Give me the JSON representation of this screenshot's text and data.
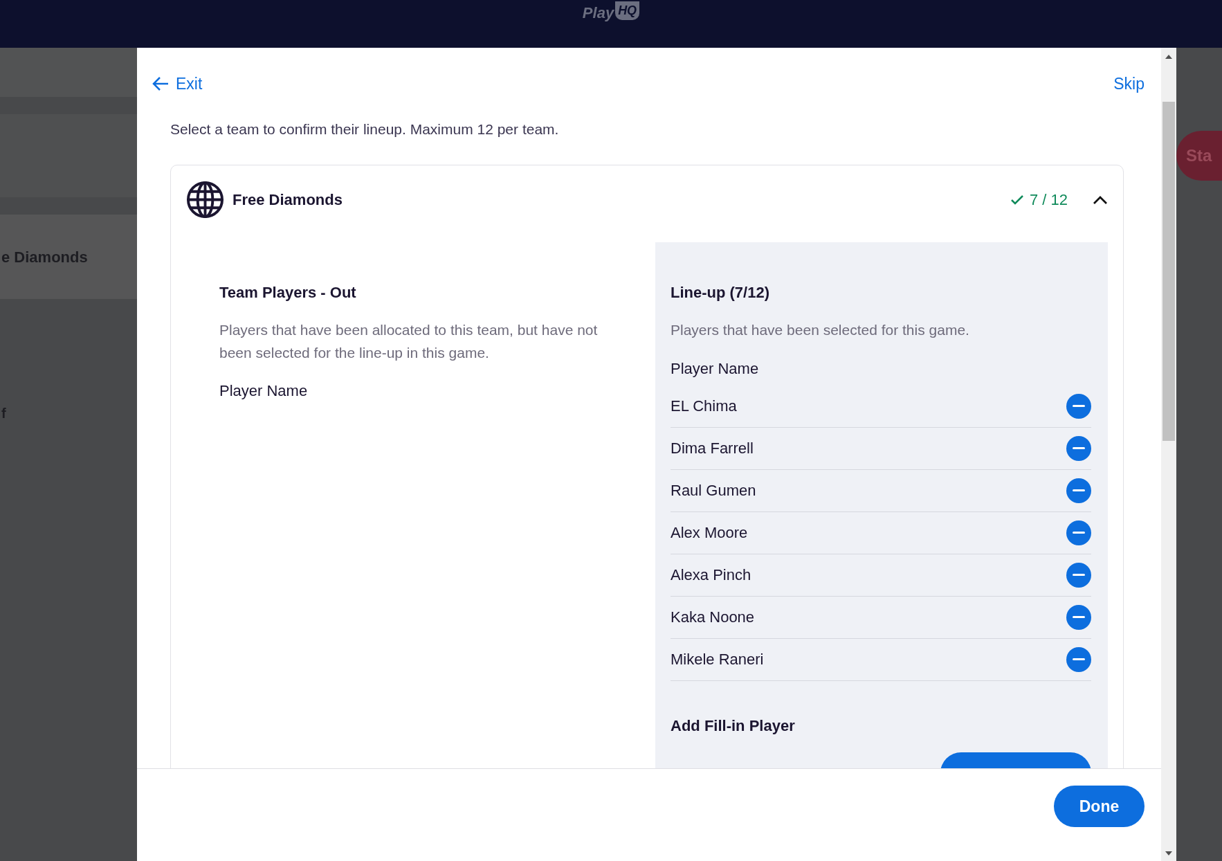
{
  "top_bar": {
    "logo": {
      "text": "Play",
      "badge": "HQ"
    }
  },
  "background": {
    "team_name": "e Diamonds",
    "fragment": "f",
    "button": "Sta"
  },
  "modal": {
    "exit": "Exit",
    "skip": "Skip",
    "intro": "Select a team to confirm their lineup. Maximum 12 per team.",
    "team": {
      "name": "Free Diamonds",
      "count": "7 / 12",
      "complete": true,
      "expanded": true,
      "out": {
        "title": "Team Players - Out",
        "description": "Players that have been allocated to this team, but have not been selected for the line-up in this game.",
        "column": "Player Name"
      },
      "lineup": {
        "title": "Line-up (7/12)",
        "description": "Players that have been selected for this game.",
        "column": "Player Name",
        "players": [
          {
            "name": "EL Chima"
          },
          {
            "name": "Dima Farrell"
          },
          {
            "name": "Raul Gumen"
          },
          {
            "name": "Alex Moore"
          },
          {
            "name": "Alexa Pinch"
          },
          {
            "name": "Kaka Noone"
          },
          {
            "name": "Mikele Raneri"
          }
        ]
      },
      "fill_in": {
        "title": "Add Fill-in Player"
      }
    },
    "done": "Done"
  }
}
